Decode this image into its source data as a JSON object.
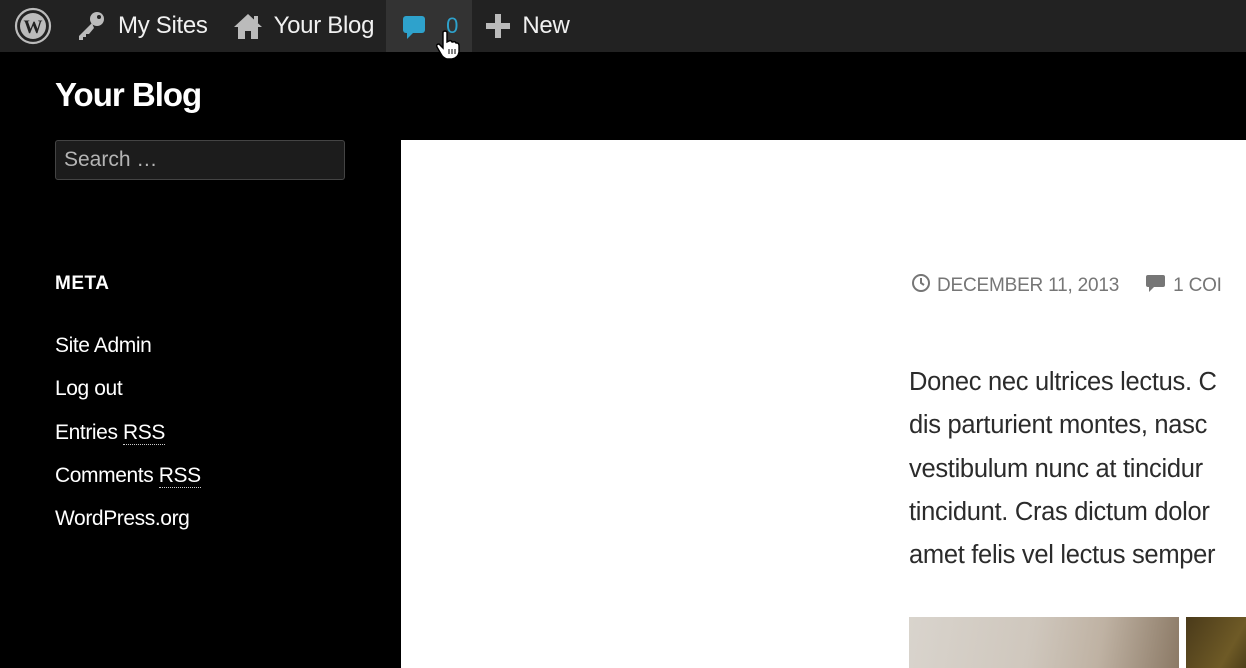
{
  "admin_bar": {
    "my_sites": "My Sites",
    "site_name": "Your Blog",
    "comments_count": "0",
    "new_label": "New"
  },
  "sidebar": {
    "site_title": "Your Blog",
    "search_placeholder": "Search …",
    "meta_widget": {
      "title": "META",
      "items": [
        "Site Admin",
        "Log out",
        "Entries ",
        "RSS",
        "Comments ",
        "WordPress.org"
      ]
    },
    "abbr": "RSS"
  },
  "post": {
    "date": "DECEMBER 11, 2013",
    "comments": "1 COI",
    "lines": [
      "Donec nec ultrices lectus. C",
      "dis parturient montes, nasc",
      "vestibulum nunc at tincidur",
      "tincidunt. Cras dictum dolor",
      "amet felis vel lectus semper"
    ]
  },
  "colors": {
    "admin_bar_bg": "#222222",
    "comment_bubble": "#2ea2cc",
    "page_bg": "#000000",
    "content_bg": "#ffffff"
  },
  "icons": [
    "wordpress-logo-icon",
    "key-icon",
    "home-icon",
    "comment-bubble-icon",
    "plus-icon",
    "clock-icon",
    "comment-icon",
    "hand-cursor-icon"
  ]
}
